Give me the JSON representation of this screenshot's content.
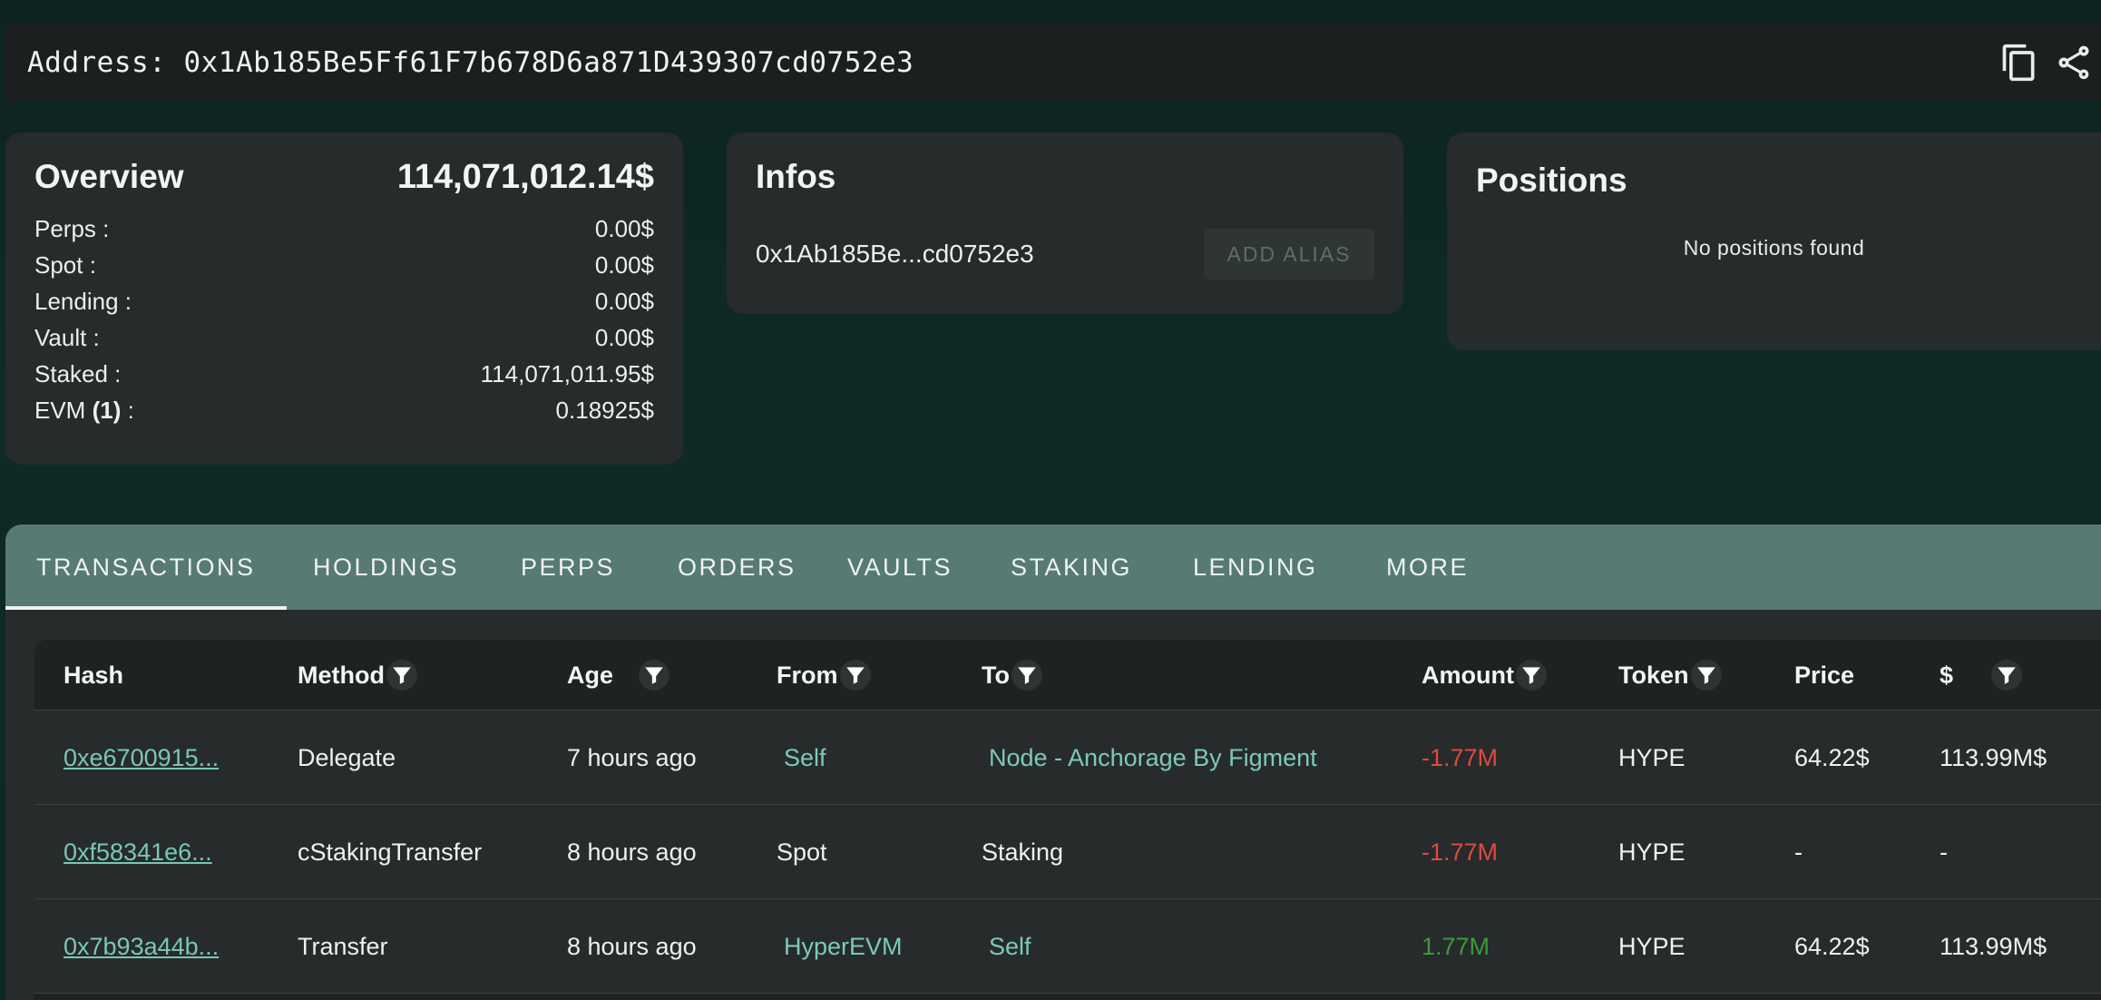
{
  "address_bar": {
    "label": "Address: 0x1Ab185Be5Ff61F7b678D6a871D439307cd0752e3",
    "copy_icon": "copy-icon",
    "share_icon": "share-icon"
  },
  "overview": {
    "title": "Overview",
    "total": "114,071,012.14$",
    "rows": [
      {
        "label": "Perps :",
        "value": "0.00$"
      },
      {
        "label": "Spot :",
        "value": "0.00$"
      },
      {
        "label": "Lending :",
        "value": "0.00$"
      },
      {
        "label": "Vault :",
        "value": "0.00$"
      },
      {
        "label": "Staked :",
        "value": "114,071,011.95$"
      },
      {
        "label_prefix": "EVM ",
        "label_bold": "(1)",
        "label_suffix": " :",
        "value": "0.18925$"
      }
    ]
  },
  "infos": {
    "title": "Infos",
    "short_address": "0x1Ab185Be...cd0752e3",
    "alias_button": "ADD ALIAS"
  },
  "positions": {
    "title": "Positions",
    "empty_text": "No positions found"
  },
  "tabs": [
    {
      "label": "TRANSACTIONS",
      "active": true
    },
    {
      "label": "HOLDINGS",
      "active": false
    },
    {
      "label": "PERPS",
      "active": false
    },
    {
      "label": "ORDERS",
      "active": false
    },
    {
      "label": "VAULTS",
      "active": false
    },
    {
      "label": "STAKING",
      "active": false
    },
    {
      "label": "LENDING",
      "active": false
    },
    {
      "label": "MORE",
      "active": false
    }
  ],
  "table": {
    "columns": [
      {
        "label": "Hash",
        "filter": false
      },
      {
        "label": "Method",
        "filter": true
      },
      {
        "label": "Age",
        "filter": true
      },
      {
        "label": "From",
        "filter": true
      },
      {
        "label": "To",
        "filter": true
      },
      {
        "label": "Amount",
        "filter": true
      },
      {
        "label": "Token",
        "filter": true
      },
      {
        "label": "Price",
        "filter": false
      },
      {
        "label": "$",
        "filter": true
      }
    ],
    "rows": [
      {
        "hash": "0xe6700915...",
        "method": "Delegate",
        "age": "7 hours ago",
        "from": "Self",
        "to": "Node - Anchorage By Figment",
        "amount": "-1.77M",
        "token": "HYPE",
        "price": "64.22$",
        "usd": "113.99M$"
      },
      {
        "hash": "0xf58341e6...",
        "method": "cStakingTransfer",
        "age": "8 hours ago",
        "from": "Spot",
        "to": "Staking",
        "amount": "-1.77M",
        "token": "HYPE",
        "price": "-",
        "usd": "-"
      },
      {
        "hash": "0x7b93a44b...",
        "method": "Transfer",
        "age": "8 hours ago",
        "from": "HyperEVM",
        "to": "Self",
        "amount": "1.77M",
        "token": "HYPE",
        "price": "64.22$",
        "usd": "113.99M$"
      }
    ]
  },
  "colors": {
    "background": "#0e231f",
    "card": "#262b2b",
    "tab_bar": "#577a72",
    "link": "#79c7b8",
    "negative": "#e0493f",
    "positive": "#3d9a3a"
  }
}
